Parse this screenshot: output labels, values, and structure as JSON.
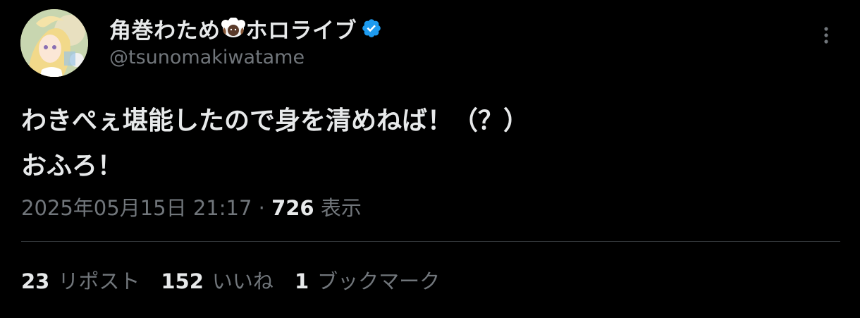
{
  "author": {
    "display_name_prefix": "角巻わため",
    "display_name_suffix": "ホロライブ",
    "sheep_emoji_icon": "sheep-face-icon",
    "handle": "@tsunomakiwatame",
    "verified_icon": "verified-badge-icon",
    "verified_color": "#1d9bf0"
  },
  "more_icon": "more-vertical-icon",
  "tweet": {
    "line1": "わきぺぇ堪能したので身を清めねば！（？）",
    "line2": "おふろ！"
  },
  "meta": {
    "timestamp": "2025年05月15日 21:17",
    "separator": " · ",
    "views_count": "726",
    "views_label": " 表示"
  },
  "stats": {
    "reposts_count": "23",
    "reposts_label": "リポスト",
    "likes_count": "152",
    "likes_label": "いいね",
    "bookmarks_count": "1",
    "bookmarks_label": "ブックマーク"
  },
  "colors": {
    "background": "#000000",
    "primary_text": "#e7e9ea",
    "secondary_text": "#71767b",
    "divider": "#2f3336"
  }
}
